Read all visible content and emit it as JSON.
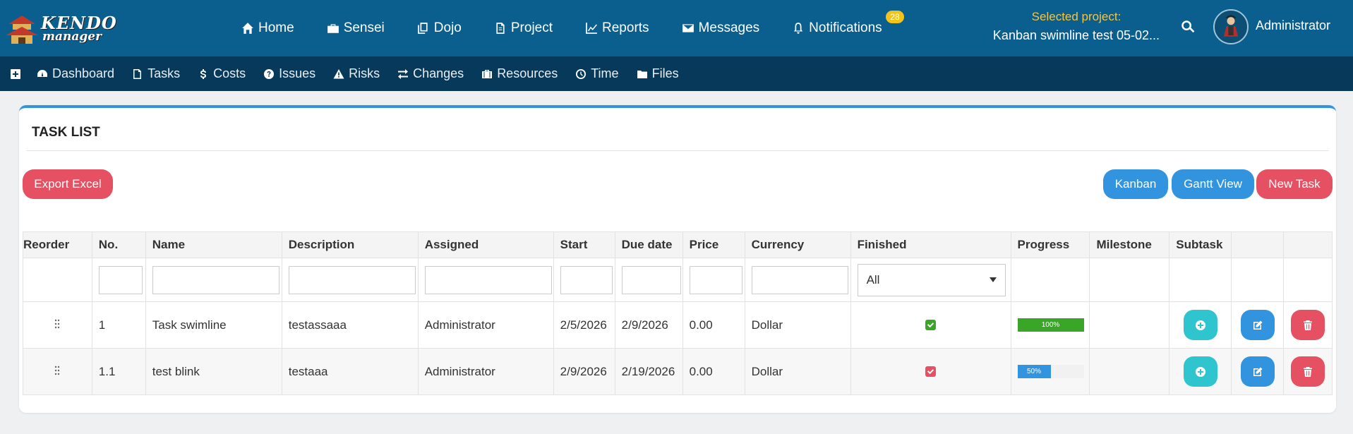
{
  "brand": {
    "line1": "KENDO",
    "line2": "manager"
  },
  "nav": {
    "items": [
      {
        "label": "Home",
        "icon": "home-icon"
      },
      {
        "label": "Sensei",
        "icon": "briefcase-icon"
      },
      {
        "label": "Dojo",
        "icon": "copy-icon"
      },
      {
        "label": "Project",
        "icon": "file-icon"
      },
      {
        "label": "Reports",
        "icon": "line-chart-icon"
      },
      {
        "label": "Messages",
        "icon": "envelope-icon"
      },
      {
        "label": "Notifications",
        "icon": "bell-icon"
      }
    ],
    "notifications_count": "28"
  },
  "selected_project": {
    "label": "Selected project:",
    "value": "Kanban swimline test 05-02..."
  },
  "user": {
    "name": "Administrator"
  },
  "subnav": {
    "items": [
      {
        "label": "Dashboard",
        "icon": "dashboard-icon"
      },
      {
        "label": "Tasks",
        "icon": "tasks-icon"
      },
      {
        "label": "Costs",
        "icon": "dollar-icon"
      },
      {
        "label": "Issues",
        "icon": "question-icon"
      },
      {
        "label": "Risks",
        "icon": "warning-icon"
      },
      {
        "label": "Changes",
        "icon": "exchange-icon"
      },
      {
        "label": "Resources",
        "icon": "suitcase-icon"
      },
      {
        "label": "Time",
        "icon": "clock-icon"
      },
      {
        "label": "Files",
        "icon": "folder-icon"
      }
    ]
  },
  "card": {
    "title": "TASK LIST",
    "export_label": "Export Excel",
    "kanban_label": "Kanban",
    "gantt_label": "Gantt View",
    "new_task_label": "New Task"
  },
  "table": {
    "headers": [
      "Reorder",
      "No.",
      "Name",
      "Description",
      "Assigned",
      "Start",
      "Due date",
      "Price",
      "Currency",
      "Finished",
      "Progress",
      "Milestone",
      "Subtask",
      "",
      ""
    ],
    "finished_filter": "All",
    "rows": [
      {
        "no": "1",
        "name": "Task swimline",
        "description": "testassaaa",
        "assigned": "Administrator",
        "start": "2/5/2026",
        "due": "2/9/2026",
        "price": "0.00",
        "currency": "Dollar",
        "finished": true,
        "progress": 100,
        "progress_label": "100%"
      },
      {
        "no": "1.1",
        "name": "test blink",
        "description": "testaaa",
        "assigned": "Administrator",
        "start": "2/9/2026",
        "due": "2/19/2026",
        "price": "0.00",
        "currency": "Dollar",
        "finished": true,
        "progress": 50,
        "progress_label": "50%"
      }
    ]
  },
  "colors": {
    "topbar": "#0a5f8e",
    "subbar": "#06395a",
    "accent_blue": "#3293de",
    "accent_red": "#e55162",
    "accent_teal": "#2ec5cf",
    "progress_green": "#3aa628",
    "check_green": "#3aa628",
    "check_red": "#e55162"
  }
}
